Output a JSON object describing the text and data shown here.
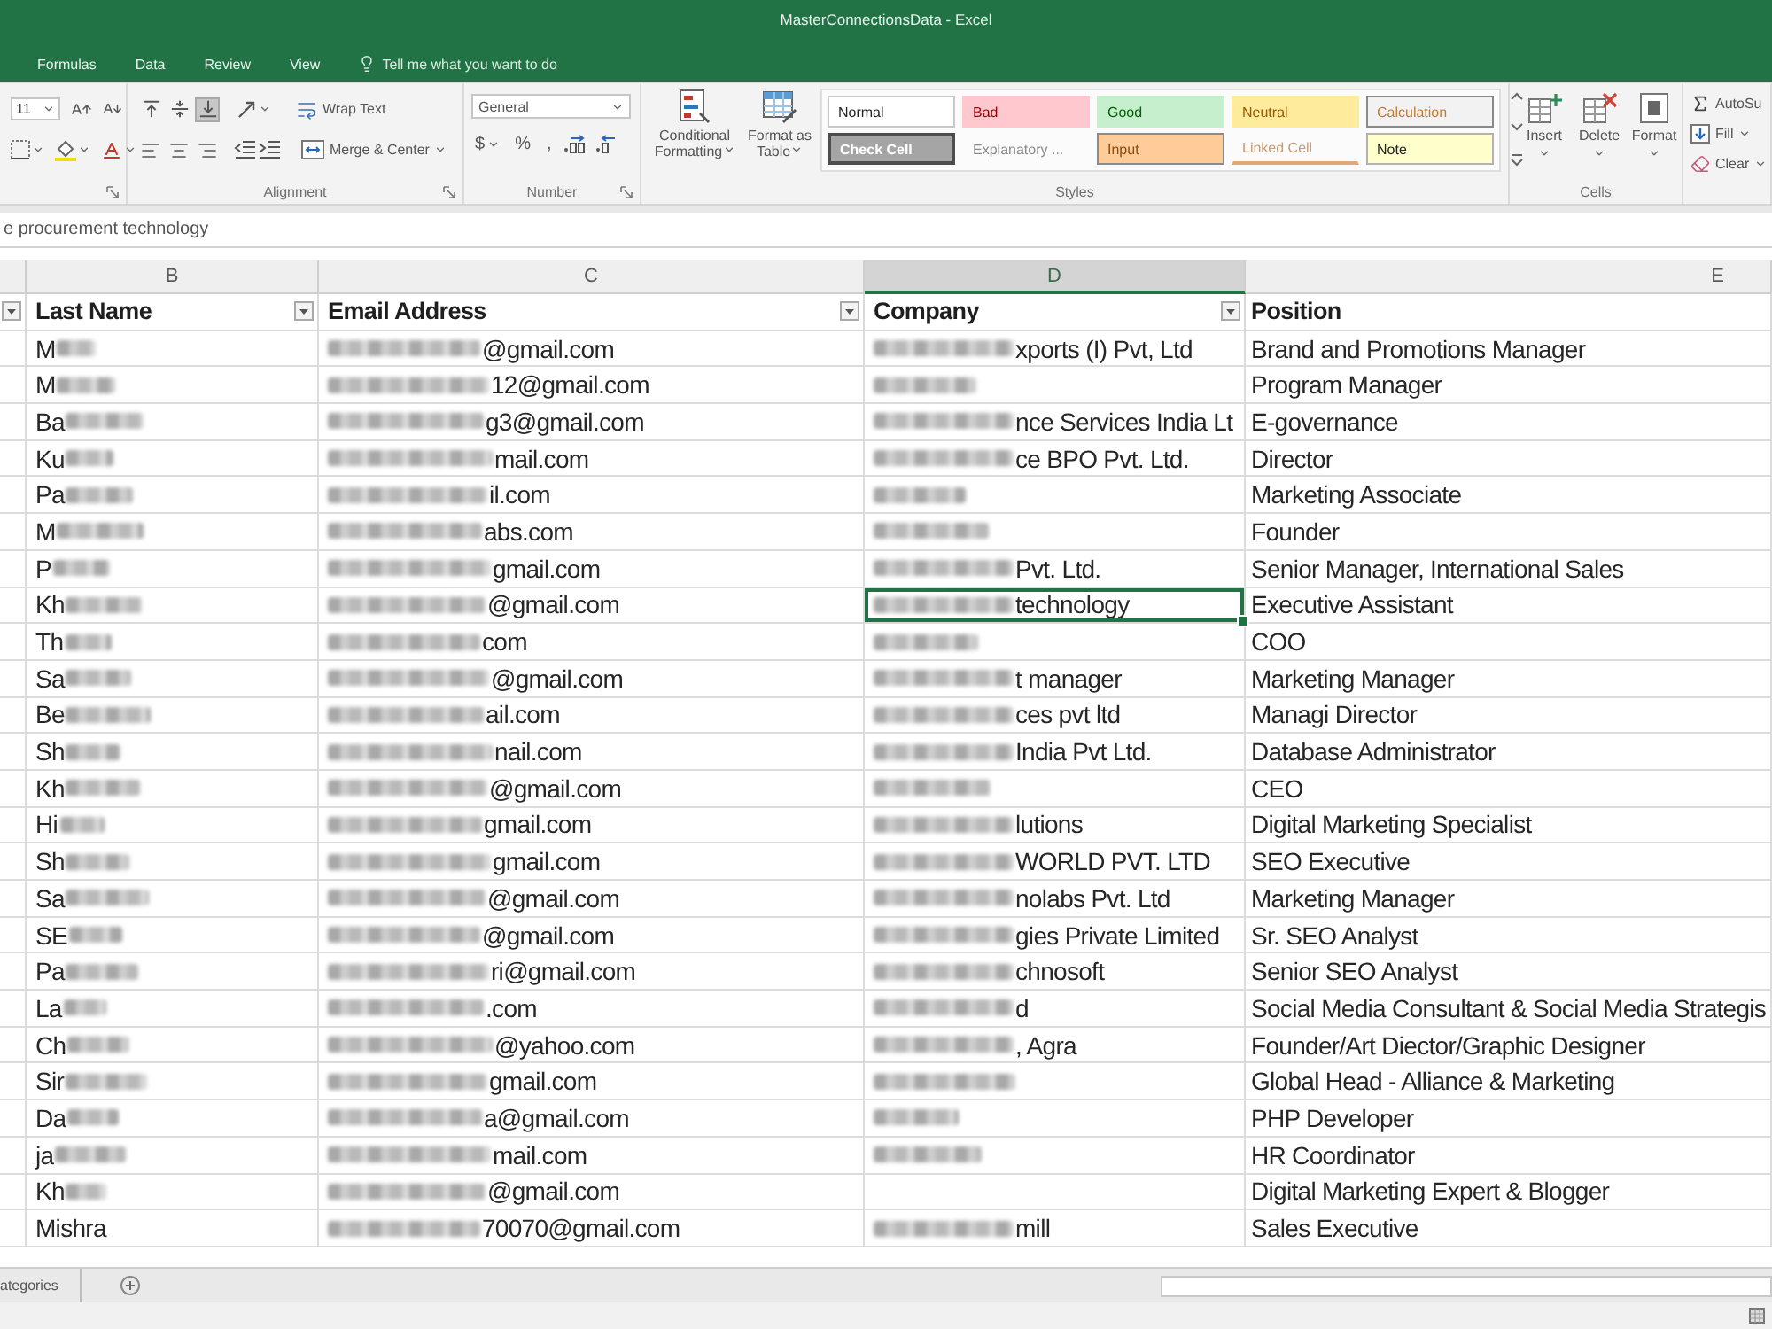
{
  "window": {
    "title": "MasterConnectionsData - Excel"
  },
  "ribbon": {
    "tabs": [
      {
        "label": "Formulas",
        "selected": false
      },
      {
        "label": "Data",
        "selected": false
      },
      {
        "label": "Review",
        "selected": false
      },
      {
        "label": "View",
        "selected": false
      }
    ],
    "tell_me": "Tell me what you want to do",
    "font": {
      "size": "11"
    },
    "alignment": {
      "vertical": [
        {
          "kind": "top",
          "selected": false
        },
        {
          "kind": "middle",
          "selected": false
        },
        {
          "kind": "bottom",
          "selected": true
        }
      ],
      "horizontal": [
        {
          "kind": "left",
          "selected": false
        },
        {
          "kind": "center",
          "selected": false
        },
        {
          "kind": "right",
          "selected": false
        }
      ],
      "wrap_text": "Wrap Text",
      "merge": "Merge & Center",
      "label": "Alignment"
    },
    "number": {
      "format": "General",
      "currency": "$",
      "percent": "%",
      "comma": ",",
      "label": "Number"
    },
    "styles": {
      "conditional": "Conditional Formatting",
      "format_table": "Format as Table",
      "gallery": [
        {
          "kind": "normal",
          "label": "Normal"
        },
        {
          "kind": "bad",
          "label": "Bad"
        },
        {
          "kind": "good",
          "label": "Good"
        },
        {
          "kind": "neutral",
          "label": "Neutral"
        },
        {
          "kind": "calculation",
          "label": "Calculation"
        },
        {
          "kind": "check",
          "label": "Check Cell"
        },
        {
          "kind": "explanatory",
          "label": "Explanatory ..."
        },
        {
          "kind": "input",
          "label": "Input"
        },
        {
          "kind": "linked",
          "label": "Linked Cell"
        },
        {
          "kind": "note",
          "label": "Note"
        }
      ],
      "label": "Styles"
    },
    "cells": {
      "buttons": [
        {
          "kind": "insert",
          "label": "Insert"
        },
        {
          "kind": "delete",
          "label": "Delete"
        },
        {
          "kind": "format",
          "label": "Format"
        }
      ],
      "label": "Cells"
    },
    "editing": [
      {
        "kind": "autosum",
        "label": "AutoSu",
        "dropdown": false
      },
      {
        "kind": "fill",
        "label": "Fill",
        "dropdown": true
      },
      {
        "kind": "clear",
        "label": "Clear",
        "dropdown": true
      }
    ]
  },
  "formula_bar": {
    "value": "e procurement technology"
  },
  "sheet": {
    "columns": [
      {
        "letter": "B",
        "selected": false
      },
      {
        "letter": "C",
        "selected": false
      },
      {
        "letter": "D",
        "selected": true
      },
      {
        "letter": "E",
        "selected": false
      }
    ],
    "headers": [
      {
        "filter": true
      },
      {
        "label": "Last Name",
        "filter": true
      },
      {
        "label": "Email Address",
        "filter": true
      },
      {
        "label": "Company",
        "filter": true
      },
      {
        "label": "Position",
        "filter": false
      }
    ],
    "rows": [
      {
        "cells": [
          {
            "text": "M",
            "blurred": true,
            "selected": false
          },
          {
            "text": "@gmail.com",
            "blurred": true,
            "selected": false
          },
          {
            "text": "xports (I) Pvt, Ltd",
            "blurred": true,
            "selected": false
          },
          {
            "text": "Brand and Promotions Manager",
            "blurred": false,
            "selected": false
          }
        ]
      },
      {
        "cells": [
          {
            "text": "M",
            "blurred": true,
            "selected": false
          },
          {
            "text": "12@gmail.com",
            "blurred": true,
            "selected": false
          },
          {
            "blurred": true,
            "selected": false
          },
          {
            "text": "Program Manager",
            "blurred": false,
            "selected": false
          }
        ]
      },
      {
        "cells": [
          {
            "text": "Ba",
            "blurred": true,
            "selected": false
          },
          {
            "text": "g3@gmail.com",
            "blurred": true,
            "selected": false
          },
          {
            "text": "nce Services India Lt",
            "blurred": true,
            "selected": false
          },
          {
            "text": "E-governance",
            "blurred": false,
            "selected": false
          }
        ]
      },
      {
        "cells": [
          {
            "text": "Ku",
            "blurred": true,
            "selected": false
          },
          {
            "text": "mail.com",
            "blurred": true,
            "selected": false
          },
          {
            "text": "ce BPO Pvt. Ltd.",
            "blurred": true,
            "selected": false
          },
          {
            "text": "Director",
            "blurred": false,
            "selected": false
          }
        ]
      },
      {
        "cells": [
          {
            "text": "Pa",
            "blurred": true,
            "selected": false
          },
          {
            "text": "il.com",
            "blurred": true,
            "selected": false
          },
          {
            "blurred": true,
            "selected": false
          },
          {
            "text": "Marketing Associate",
            "blurred": false,
            "selected": false
          }
        ]
      },
      {
        "cells": [
          {
            "text": "M",
            "blurred": true,
            "selected": false
          },
          {
            "text": "abs.com",
            "blurred": true,
            "selected": false
          },
          {
            "blurred": true,
            "selected": false
          },
          {
            "text": "Founder",
            "blurred": false,
            "selected": false
          }
        ]
      },
      {
        "cells": [
          {
            "text": "P",
            "blurred": true,
            "selected": false
          },
          {
            "text": "gmail.com",
            "blurred": true,
            "selected": false
          },
          {
            "text": "Pvt. Ltd.",
            "blurred": true,
            "selected": false
          },
          {
            "text": "Senior Manager, International Sales",
            "blurred": false,
            "selected": false
          }
        ]
      },
      {
        "cells": [
          {
            "text": "Kh",
            "blurred": true,
            "selected": false
          },
          {
            "text": "@gmail.com",
            "blurred": true,
            "selected": false
          },
          {
            "text": "technology",
            "blurred": true,
            "selected": true
          },
          {
            "text": "Executive Assistant",
            "blurred": false,
            "selected": false
          }
        ]
      },
      {
        "cells": [
          {
            "text": "Th",
            "blurred": true,
            "selected": false
          },
          {
            "text": "com",
            "blurred": true,
            "selected": false
          },
          {
            "blurred": true,
            "selected": false
          },
          {
            "text": "COO",
            "blurred": false,
            "selected": false
          }
        ]
      },
      {
        "cells": [
          {
            "text": "Sa",
            "blurred": true,
            "selected": false
          },
          {
            "text": "@gmail.com",
            "blurred": true,
            "selected": false
          },
          {
            "text": "t manager",
            "blurred": true,
            "selected": false
          },
          {
            "text": "Marketing Manager",
            "blurred": false,
            "selected": false
          }
        ]
      },
      {
        "cells": [
          {
            "text": "Be",
            "blurred": true,
            "selected": false
          },
          {
            "text": "ail.com",
            "blurred": true,
            "selected": false
          },
          {
            "text": "ces pvt ltd",
            "blurred": true,
            "selected": false
          },
          {
            "text": "Managi Director",
            "blurred": false,
            "selected": false
          }
        ]
      },
      {
        "cells": [
          {
            "text": "Sh",
            "blurred": true,
            "selected": false
          },
          {
            "text": "nail.com",
            "blurred": true,
            "selected": false
          },
          {
            "text": "India Pvt Ltd.",
            "blurred": true,
            "selected": false
          },
          {
            "text": "Database Administrator",
            "blurred": false,
            "selected": false
          }
        ]
      },
      {
        "cells": [
          {
            "text": "Kh",
            "blurred": true,
            "selected": false
          },
          {
            "text": "@gmail.com",
            "blurred": true,
            "selected": false
          },
          {
            "blurred": true,
            "selected": false
          },
          {
            "text": "CEO",
            "blurred": false,
            "selected": false
          }
        ]
      },
      {
        "cells": [
          {
            "text": "Hi",
            "blurred": true,
            "selected": false
          },
          {
            "text": "gmail.com",
            "blurred": true,
            "selected": false
          },
          {
            "text": "lutions",
            "blurred": true,
            "selected": false
          },
          {
            "text": "Digital Marketing Specialist",
            "blurred": false,
            "selected": false
          }
        ]
      },
      {
        "cells": [
          {
            "text": "Sh",
            "blurred": true,
            "selected": false
          },
          {
            "text": "gmail.com",
            "blurred": true,
            "selected": false
          },
          {
            "text": "WORLD PVT. LTD",
            "blurred": true,
            "selected": false
          },
          {
            "text": "SEO Executive",
            "blurred": false,
            "selected": false
          }
        ]
      },
      {
        "cells": [
          {
            "text": "Sa",
            "blurred": true,
            "selected": false
          },
          {
            "text": "@gmail.com",
            "blurred": true,
            "selected": false
          },
          {
            "text": "nolabs Pvt. Ltd",
            "blurred": true,
            "selected": false
          },
          {
            "text": "Marketing Manager",
            "blurred": false,
            "selected": false
          }
        ]
      },
      {
        "cells": [
          {
            "text": "SE",
            "blurred": true,
            "selected": false
          },
          {
            "text": "@gmail.com",
            "blurred": true,
            "selected": false
          },
          {
            "text": "gies Private Limited",
            "blurred": true,
            "selected": false
          },
          {
            "text": "Sr. SEO Analyst",
            "blurred": false,
            "selected": false
          }
        ]
      },
      {
        "cells": [
          {
            "text": "Pa",
            "blurred": true,
            "selected": false
          },
          {
            "text": "ri@gmail.com",
            "blurred": true,
            "selected": false
          },
          {
            "text": "chnosoft",
            "blurred": true,
            "selected": false
          },
          {
            "text": "Senior SEO Analyst",
            "blurred": false,
            "selected": false
          }
        ]
      },
      {
        "cells": [
          {
            "text": "La",
            "blurred": true,
            "selected": false
          },
          {
            "text": ".com",
            "blurred": true,
            "selected": false
          },
          {
            "text": "d",
            "blurred": true,
            "selected": false
          },
          {
            "text": "Social Media Consultant & Social Media Strategis",
            "blurred": false,
            "selected": false
          }
        ]
      },
      {
        "cells": [
          {
            "text": "Ch",
            "blurred": true,
            "selected": false
          },
          {
            "text": "@yahoo.com",
            "blurred": true,
            "selected": false
          },
          {
            "text": ", Agra",
            "blurred": true,
            "selected": false
          },
          {
            "text": "Founder/Art Diector/Graphic Designer",
            "blurred": false,
            "selected": false
          }
        ]
      },
      {
        "cells": [
          {
            "text": "Sir",
            "blurred": true,
            "selected": false
          },
          {
            "text": "gmail.com",
            "blurred": true,
            "selected": false
          },
          {
            "blurred": true,
            "selected": false
          },
          {
            "text": "Global Head - Alliance & Marketing",
            "blurred": false,
            "selected": false
          }
        ]
      },
      {
        "cells": [
          {
            "text": "Da",
            "blurred": true,
            "selected": false
          },
          {
            "text": "a@gmail.com",
            "blurred": true,
            "selected": false
          },
          {
            "blurred": true,
            "selected": false
          },
          {
            "text": "PHP Developer",
            "blurred": false,
            "selected": false
          }
        ]
      },
      {
        "cells": [
          {
            "text": "ja",
            "blurred": true,
            "selected": false
          },
          {
            "text": "mail.com",
            "blurred": true,
            "selected": false
          },
          {
            "blurred": true,
            "selected": false
          },
          {
            "text": "HR Coordinator",
            "blurred": false,
            "selected": false
          }
        ]
      },
      {
        "cells": [
          {
            "text": "Kh",
            "blurred": true,
            "selected": false
          },
          {
            "text": "@gmail.com",
            "blurred": true,
            "selected": false
          },
          {
            "blurred": false,
            "selected": false
          },
          {
            "text": "Digital Marketing Expert & Blogger",
            "blurred": false,
            "selected": false
          }
        ]
      },
      {
        "cells": [
          {
            "text": "Mishra",
            "blurred": false,
            "selected": false
          },
          {
            "text": "70070@gmail.com",
            "blurred": true,
            "selected": false
          },
          {
            "text": "mill",
            "blurred": true,
            "selected": false
          },
          {
            "text": "Sales Executive",
            "blurred": false,
            "selected": false
          }
        ]
      }
    ]
  },
  "sheet_tabs": [
    {
      "label": "ategories"
    }
  ]
}
